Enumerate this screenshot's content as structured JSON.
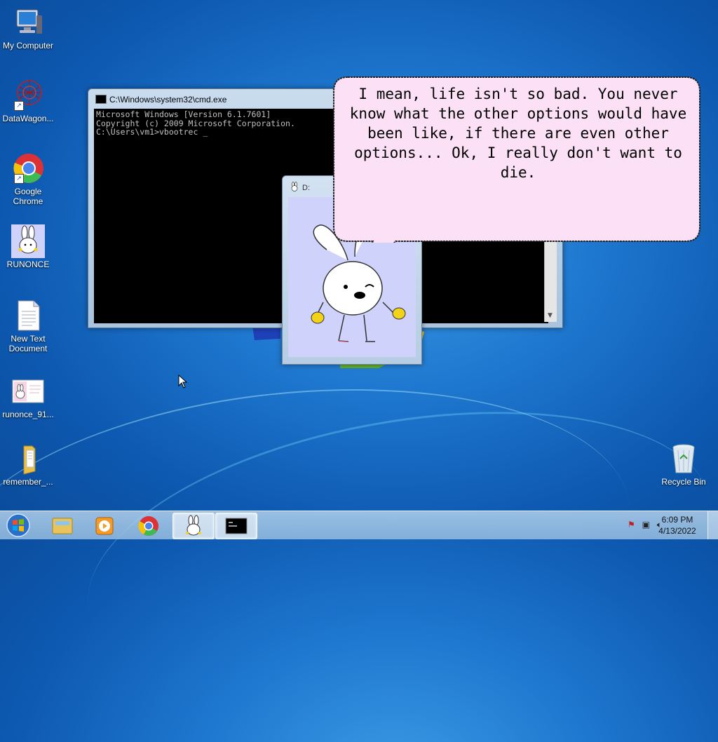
{
  "desktop": {
    "icons": [
      {
        "label": "My Computer",
        "icon": "computer-icon"
      },
      {
        "label": "DataWagon...",
        "icon": "datawagon-icon"
      },
      {
        "label": "Google Chrome",
        "icon": "chrome-icon"
      },
      {
        "label": "RUNONCE",
        "icon": "bunny-icon"
      },
      {
        "label": "New Text Document",
        "icon": "text-document-icon"
      },
      {
        "label": "runonce_91...",
        "icon": "image-file-icon"
      },
      {
        "label": "remember_...",
        "icon": "folder-icon"
      },
      {
        "label": "Recycle Bin",
        "icon": "recycle-bin-icon"
      }
    ]
  },
  "cmd_window": {
    "title": "C:\\Windows\\system32\\cmd.exe",
    "lines": [
      "Microsoft Windows [Version 6.1.7601]",
      "Copyright (c) 2009 Microsoft Corporation.",
      "",
      "C:\\Users\\vm1>vbootrec _"
    ]
  },
  "d_window": {
    "title": "D:"
  },
  "speech_bubble": {
    "text": "I mean, life isn't so bad. You never know what the other options would have been like, if there are even other options... Ok, I really don't want to die."
  },
  "taskbar": {
    "pinned": [
      "start-button",
      "explorer",
      "media-player",
      "chrome",
      "runonce",
      "cmd"
    ],
    "clock_time": "6:09 PM",
    "clock_date": "4/13/2022"
  }
}
